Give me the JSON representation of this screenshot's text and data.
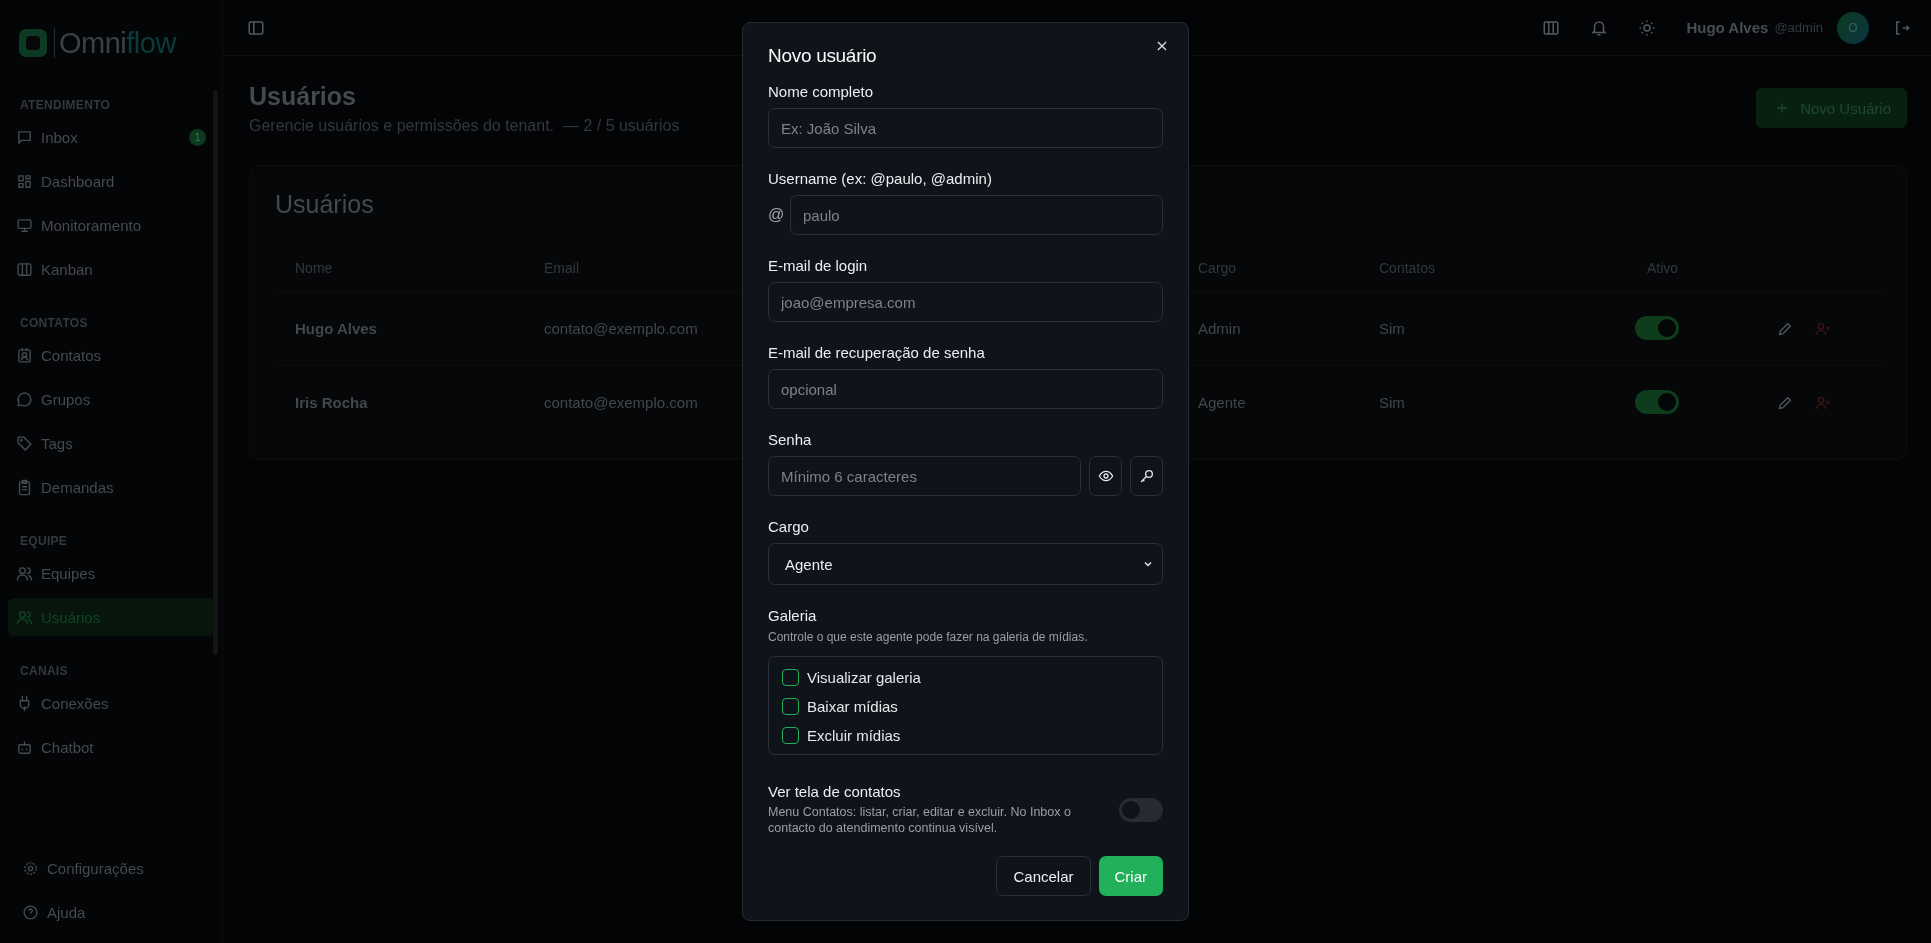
{
  "sidebar": {
    "brand_parts": [
      "Omni",
      "flow"
    ],
    "sections": [
      {
        "title": "ATENDIMENTO",
        "items": [
          {
            "label": "Inbox",
            "selected": false,
            "badge": "1"
          },
          {
            "label": "Dashboard",
            "selected": false
          },
          {
            "label": "Monitoramento",
            "selected": false
          },
          {
            "label": "Kanban",
            "selected": false
          }
        ]
      },
      {
        "title": "CONTATOS",
        "items": [
          {
            "label": "Contatos",
            "selected": false
          },
          {
            "label": "Grupos",
            "selected": false
          },
          {
            "label": "Tags",
            "selected": false
          },
          {
            "label": "Demandas",
            "selected": false
          }
        ]
      },
      {
        "title": "EQUIPE",
        "items": [
          {
            "label": "Equipes",
            "selected": false
          },
          {
            "label": "Usuários",
            "selected": true
          }
        ]
      },
      {
        "title": "CANAIS",
        "items": [
          {
            "label": "Conexões",
            "selected": false
          },
          {
            "label": "Chatbot",
            "selected": false
          }
        ]
      }
    ],
    "footer_items": [
      {
        "label": "Configurações"
      },
      {
        "label": "Ajuda"
      }
    ]
  },
  "header": {
    "user_name": "Hugo Alves",
    "user_handle": "@admin",
    "avatar_initial": "O"
  },
  "page": {
    "title": "Usuários",
    "subtitle": "Gerencie usuários e permissões do tenant.  — 2 / 5 usuários",
    "new_button": "Novo Usuário"
  },
  "table": {
    "title": "Usuários",
    "columns": [
      "Nome",
      "Email",
      "Cargo",
      "Contatos",
      "Ativo"
    ],
    "rows": [
      {
        "cells": [
          "Hugo Alves",
          "contato@exemplo.com",
          "Admin",
          "Sim"
        ],
        "active": true
      },
      {
        "cells": [
          "Iris Rocha",
          "contato@exemplo.com",
          "Agente",
          "Sim"
        ],
        "active": true
      }
    ]
  },
  "dialog": {
    "title": "Novo usuário",
    "fields": [
      {
        "kind": "text",
        "label": "Nome completo",
        "placeholder": "Ex: João Silva"
      },
      {
        "kind": "prefixed",
        "label": "Username (ex: @paulo, @admin)",
        "prefix": "@",
        "placeholder": "paulo"
      },
      {
        "kind": "text",
        "label": "E-mail de login",
        "placeholder": "joao@empresa.com"
      },
      {
        "kind": "text",
        "label": "E-mail de recuperação de senha",
        "placeholder": "opcional"
      },
      {
        "kind": "password",
        "label": "Senha",
        "placeholder": "Mínimo 6 caracteres"
      },
      {
        "kind": "select",
        "label": "Cargo",
        "value": "Agente"
      }
    ],
    "gallery": {
      "title": "Galeria",
      "description": "Controle o que este agente pode fazer na galeria de mídias.",
      "options": [
        {
          "label": "Visualizar galeria",
          "checked": false
        },
        {
          "label": "Baixar mídias",
          "checked": false
        },
        {
          "label": "Excluir mídias",
          "checked": false
        }
      ]
    },
    "contacts_toggle": {
      "title": "Ver tela de contatos",
      "description": "Menu Contatos: listar, criar, editar e excluir. No Inbox o contacto do atendimento continua visível.",
      "on": false
    },
    "buttons": {
      "cancel": "Cancelar",
      "submit": "Criar"
    }
  }
}
